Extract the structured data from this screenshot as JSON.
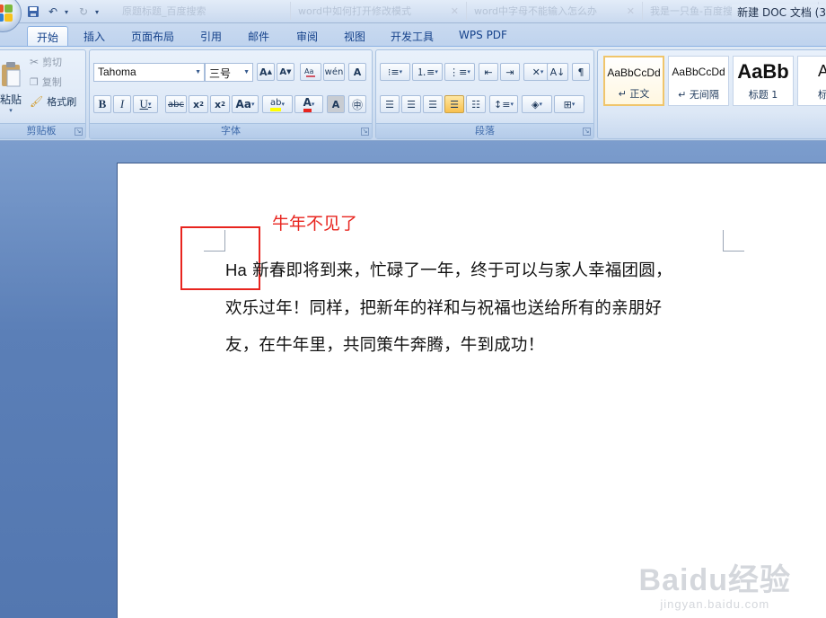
{
  "titlebar": {
    "task_tabs": [
      "原题标题_百度搜索",
      "word中如何打开修改模式",
      "word中字母不能输入怎么办",
      "我是一只鱼-百度搜索"
    ],
    "doc_title": "新建 DOC 文档 (3"
  },
  "ribbon_tabs": [
    "开始",
    "插入",
    "页面布局",
    "引用",
    "邮件",
    "审阅",
    "视图",
    "开发工具",
    "WPS PDF"
  ],
  "clipboard": {
    "paste_label": "粘贴",
    "cut_label": "剪切",
    "copy_label": "复制",
    "format_painter_label": "格式刷",
    "group_label": "剪贴板"
  },
  "font": {
    "font_name": "Tahoma",
    "font_size": "三号",
    "group_label": "字体"
  },
  "paragraph": {
    "group_label": "段落"
  },
  "styles": [
    {
      "sample": "AaBbCcDd",
      "name": "↵ 正文"
    },
    {
      "sample": "AaBbCcDd",
      "name": "↵ 无间隔"
    },
    {
      "sample": "AaBb",
      "name": "标题 1"
    },
    {
      "sample": "Aa",
      "name": "标题"
    }
  ],
  "document": {
    "annotation": "牛年不见了",
    "first_word": "Ha",
    "line1": " 新春即将到来，忙碌了一年，终于可以与家人幸福团圆，",
    "line2": "欢乐过年！同样，把新年的祥和与祝福也送给所有的亲朋好",
    "line3": "友，在牛年里，共同策牛奔腾，牛到成功！"
  },
  "watermark": {
    "brand": "Baidu经验",
    "url": "jingyan.baidu.com"
  },
  "colors": {
    "annotation_red": "#e8251f",
    "ribbon_text": "#15428b"
  }
}
